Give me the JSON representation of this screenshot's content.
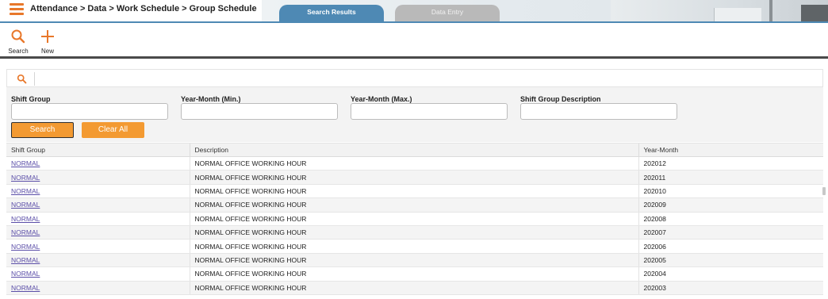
{
  "header": {
    "breadcrumb": "Attendance > Data > Work Schedule > Group Schedule",
    "tabs": [
      {
        "label": "Search Results",
        "active": true
      },
      {
        "label": "Data Entry",
        "active": false
      }
    ],
    "menu_icon": "hamburger-menu-icon"
  },
  "toolbar": {
    "search_label": "Search",
    "new_label": "New",
    "search_icon": "search-icon",
    "new_icon": "plus-icon"
  },
  "filters": {
    "fields": [
      {
        "label": "Shift Group",
        "value": "",
        "placeholder": ""
      },
      {
        "label": "Year-Month (Min.)",
        "value": "",
        "placeholder": ""
      },
      {
        "label": "Year-Month (Max.)",
        "value": "",
        "placeholder": ""
      },
      {
        "label": "Shift Group Description",
        "value": "",
        "placeholder": ""
      }
    ],
    "search_button": "Search",
    "clear_button": "Clear All"
  },
  "table": {
    "columns": [
      "Shift Group",
      "Description",
      "Year-Month"
    ],
    "rows": [
      [
        "NORMAL",
        "NORMAL OFFICE WORKING HOUR",
        "202012"
      ],
      [
        "NORMAL",
        "NORMAL OFFICE WORKING HOUR",
        "202011"
      ],
      [
        "NORMAL",
        "NORMAL OFFICE WORKING HOUR",
        "202010"
      ],
      [
        "NORMAL",
        "NORMAL OFFICE WORKING HOUR",
        "202009"
      ],
      [
        "NORMAL",
        "NORMAL OFFICE WORKING HOUR",
        "202008"
      ],
      [
        "NORMAL",
        "NORMAL OFFICE WORKING HOUR",
        "202007"
      ],
      [
        "NORMAL",
        "NORMAL OFFICE WORKING HOUR",
        "202006"
      ],
      [
        "NORMAL",
        "NORMAL OFFICE WORKING HOUR",
        "202005"
      ],
      [
        "NORMAL",
        "NORMAL OFFICE WORKING HOUR",
        "202004"
      ],
      [
        "NORMAL",
        "NORMAL OFFICE WORKING HOUR",
        "202003"
      ]
    ]
  },
  "colors": {
    "accent": "#e8772a",
    "button": "#f39a32",
    "tab_active": "#4e89b4",
    "tab_inactive": "#b9b9b9",
    "link": "#5b4ea8"
  }
}
